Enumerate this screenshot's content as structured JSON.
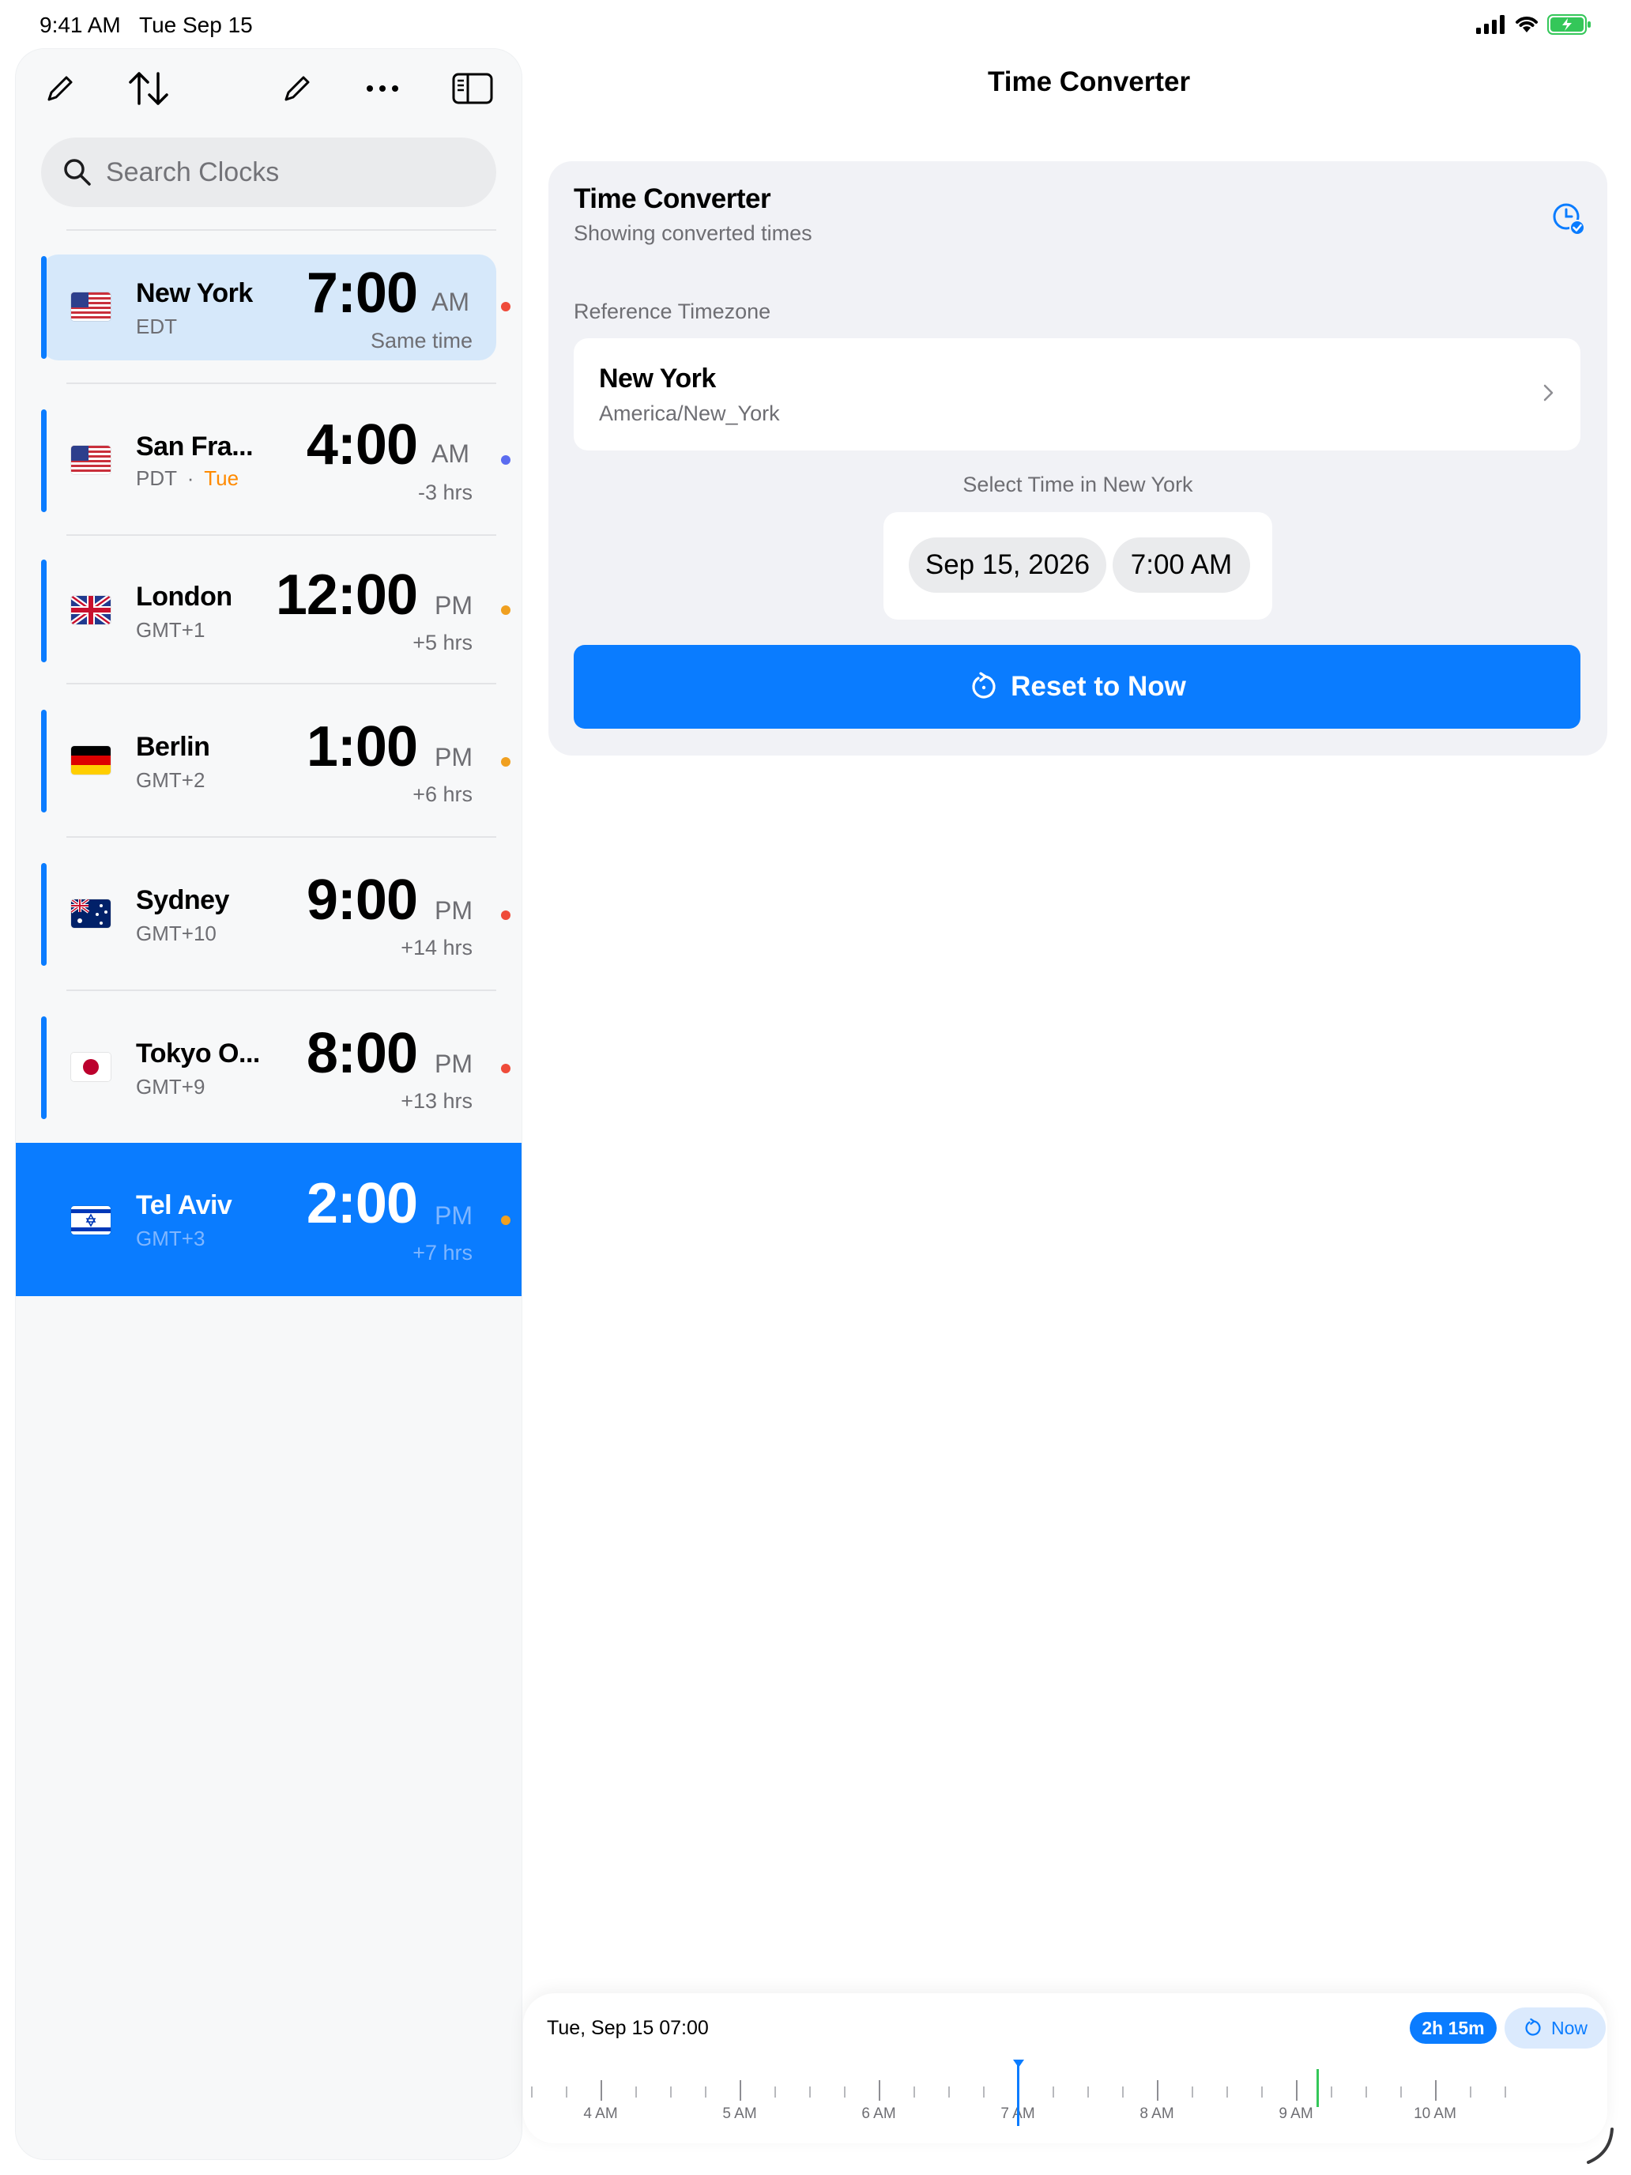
{
  "status": {
    "time": "9:41 AM",
    "date": "Tue Sep 15"
  },
  "sidebar": {
    "search_placeholder": "Search Clocks",
    "clocks": [
      {
        "city": "New York",
        "tz": "EDT",
        "tz_extra": "",
        "time": "7:00",
        "ampm": "AM",
        "offset": "Same time",
        "dot": "#ef4b3a",
        "flag": "us"
      },
      {
        "city": "San Fra...",
        "tz": "PDT",
        "tz_extra": "Tue",
        "time": "4:00",
        "ampm": "AM",
        "offset": "-3 hrs",
        "dot": "#5b6cf0",
        "flag": "us"
      },
      {
        "city": "London",
        "tz": "GMT+1",
        "tz_extra": "",
        "time": "12:00",
        "ampm": "PM",
        "offset": "+5 hrs",
        "dot": "#f0a020",
        "flag": "uk"
      },
      {
        "city": "Berlin",
        "tz": "GMT+2",
        "tz_extra": "",
        "time": "1:00",
        "ampm": "PM",
        "offset": "+6 hrs",
        "dot": "#f0a020",
        "flag": "de"
      },
      {
        "city": "Sydney",
        "tz": "GMT+10",
        "tz_extra": "",
        "time": "9:00",
        "ampm": "PM",
        "offset": "+14 hrs",
        "dot": "#ef4b3a",
        "flag": "au"
      },
      {
        "city": "Tokyo O...",
        "tz": "GMT+9",
        "tz_extra": "",
        "time": "8:00",
        "ampm": "PM",
        "offset": "+13 hrs",
        "dot": "#ef4b3a",
        "flag": "jp"
      },
      {
        "city": "Tel Aviv",
        "tz": "GMT+3",
        "tz_extra": "",
        "time": "2:00",
        "ampm": "PM",
        "offset": "+7 hrs",
        "dot": "#f0a020",
        "flag": "il"
      }
    ]
  },
  "main": {
    "title": "Time Converter",
    "card": {
      "title": "Time Converter",
      "subtitle": "Showing converted times",
      "ref_label": "Reference Timezone",
      "ref_city": "New York",
      "ref_zone": "America/New_York",
      "select_label": "Select Time in New York",
      "date_value": "Sep 15, 2026",
      "time_value": "7:00 AM",
      "reset_label": "Reset to Now"
    }
  },
  "timeline": {
    "current": "Tue, Sep 15 07:00",
    "duration": "2h 15m",
    "now_label": "Now",
    "hour_labels": [
      "4 AM",
      "5 AM",
      "6 AM",
      "7 AM",
      "8 AM",
      "9 AM",
      "10 AM"
    ],
    "accent": "#0a7cff",
    "now_marker_color": "#34c759"
  }
}
